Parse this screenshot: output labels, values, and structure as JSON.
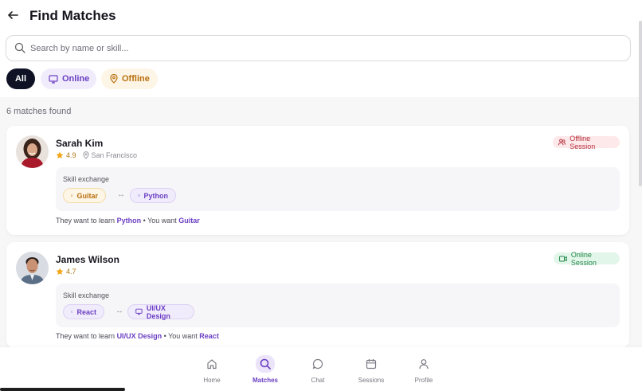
{
  "header": {
    "title": "Find Matches"
  },
  "search": {
    "placeholder": "Search by name or skill..."
  },
  "filters": {
    "all": "All",
    "online": "Online",
    "offline": "Offline"
  },
  "results": {
    "count_text": "6 matches found"
  },
  "matches": [
    {
      "name": "Sarah Kim",
      "rating": "4.9",
      "location": "San Francisco",
      "session": "Offline Session",
      "exchange_label": "Skill exchange",
      "offer": "Guitar",
      "want": "Python",
      "learn_prefix": "They want to learn",
      "learn_skill": "Python",
      "want_prefix": "• You want",
      "want_skill": "Guitar"
    },
    {
      "name": "James Wilson",
      "rating": "4.7",
      "session": "Online Session",
      "exchange_label": "Skill exchange",
      "offer": "React",
      "want": "UI/UX Design",
      "learn_prefix": "They want to learn",
      "learn_skill": "UI/UX Design",
      "want_prefix": "• You want",
      "want_skill": "React"
    }
  ],
  "nav": {
    "home": "Home",
    "matches": "Matches",
    "chat": "Chat",
    "sessions": "Sessions",
    "profile": "Profile"
  },
  "colors": {
    "accent": "#6b3fc4",
    "offline": "#b8700f",
    "online_badge": "#23874a",
    "offline_badge": "#b6303d",
    "star": "#f2a516"
  },
  "icons": [
    "back-arrow-icon",
    "search-icon",
    "monitor-icon",
    "map-pin-icon",
    "star-icon",
    "users-icon",
    "video-icon",
    "home-icon",
    "chat-icon",
    "calendar-icon",
    "user-icon"
  ]
}
